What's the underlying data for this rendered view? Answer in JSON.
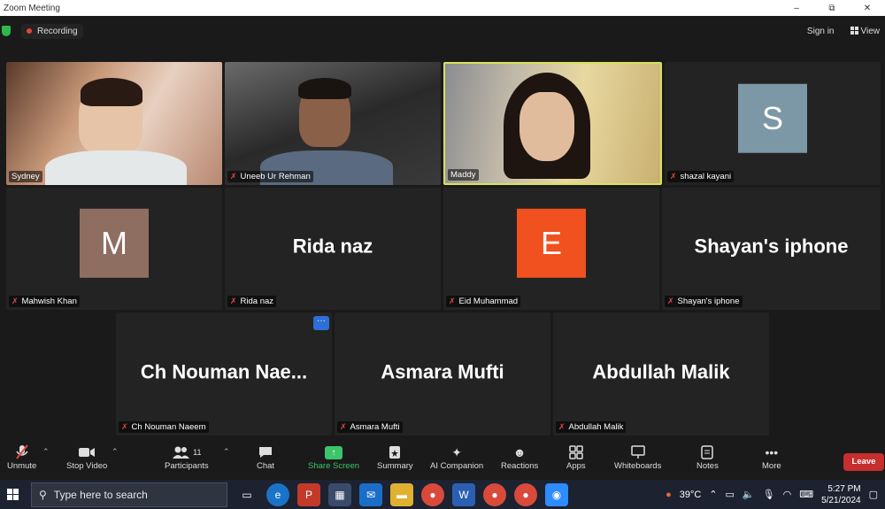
{
  "window": {
    "title": "Zoom Meeting",
    "minimize": "–",
    "restore": "⧉",
    "close": "✕"
  },
  "topbar": {
    "recording_label": "Recording",
    "sign_in": "Sign in",
    "view": "View"
  },
  "participants": [
    {
      "name": "Sydney",
      "kind": "video",
      "muted": false
    },
    {
      "name": "Uneeb Ur Rehman",
      "kind": "video",
      "muted": true
    },
    {
      "name": "Maddy",
      "kind": "video",
      "muted": false,
      "active_speaker": true
    },
    {
      "name": "shazal kayani",
      "kind": "avatar",
      "initial": "S",
      "avatar_color": "#7c97a6",
      "muted": true
    },
    {
      "name": "Mahwish Khan",
      "kind": "avatar",
      "initial": "M",
      "avatar_color": "#8f6e62",
      "muted": true
    },
    {
      "name": "Rida naz",
      "kind": "name",
      "display": "Rida naz",
      "muted": true
    },
    {
      "name": "Eid Muhammad",
      "kind": "avatar",
      "initial": "E",
      "avatar_color": "#f0511e",
      "muted": true
    },
    {
      "name": "Shayan's iphone",
      "kind": "name",
      "display": "Shayan's iphone",
      "muted": true
    },
    {
      "name": "Ch Nouman Naeem",
      "kind": "name",
      "display": "Ch Nouman Nae...",
      "muted": true
    },
    {
      "name": "Asmara Mufti",
      "kind": "name",
      "display": "Asmara Mufti",
      "muted": true
    },
    {
      "name": "Abdullah Malik",
      "kind": "name",
      "display": "Abdullah Malik",
      "muted": true
    }
  ],
  "more_options_glyph": "···",
  "toolbar": {
    "unmute": "Unmute",
    "stop_video": "Stop Video",
    "participants": "Participants",
    "participants_count": "11",
    "chat": "Chat",
    "share_screen": "Share Screen",
    "summary": "Summary",
    "ai_companion": "AI Companion",
    "reactions": "Reactions",
    "apps": "Apps",
    "whiteboards": "Whiteboards",
    "notes": "Notes",
    "more": "More",
    "leave": "Leave"
  },
  "taskbar": {
    "search_placeholder": "Type here to search",
    "temperature": "39°C",
    "time": "5:27 PM",
    "date": "5/21/2024",
    "apps": [
      "task-view",
      "edge",
      "pdf",
      "store",
      "mail",
      "files",
      "chrome",
      "word",
      "chrome-2",
      "chrome-3",
      "zoom"
    ]
  },
  "colors": {
    "active_border": "#d6e25a",
    "leave": "#c72e2e",
    "share": "#3bc46a",
    "muted": "#e0463c"
  }
}
